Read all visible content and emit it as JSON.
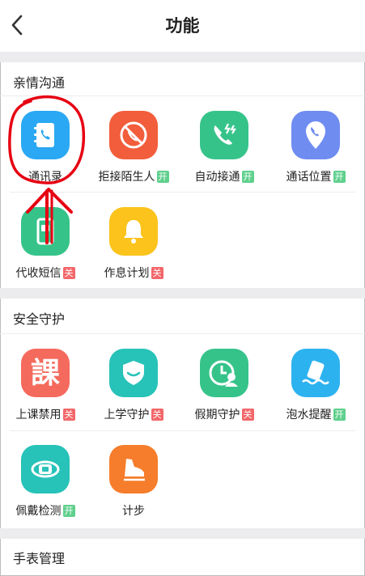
{
  "header": {
    "title": "功能"
  },
  "colors": {
    "blue": "#2aa8f3",
    "red": "#f25d3b",
    "green": "#36c38a",
    "purple": "#6f8cf1",
    "yellow": "#fbc31c",
    "coral": "#f46a5d",
    "teal": "#27c2b8",
    "sky": "#2db2f0",
    "orange": "#f67d2b",
    "badge_on": "#5fd08d",
    "badge_off": "#f2676a",
    "annotation": "#e60012"
  },
  "sections": [
    {
      "title": "亲情沟通",
      "items": [
        {
          "label": "通讯录",
          "badge": "",
          "icon": "contacts-book-icon"
        },
        {
          "label": "拒接陌生人",
          "badge": "开",
          "icon": "block-call-icon"
        },
        {
          "label": "自动接通",
          "badge": "开",
          "icon": "auto-answer-icon"
        },
        {
          "label": "通话位置",
          "badge": "开",
          "icon": "call-location-icon"
        },
        {
          "label": "代收短信",
          "badge": "关",
          "icon": "sms-receive-icon"
        },
        {
          "label": "作息计划",
          "badge": "关",
          "icon": "bell-icon"
        }
      ]
    },
    {
      "title": "安全守护",
      "items": [
        {
          "label": "上课禁用",
          "badge": "关",
          "icon": "class-character-icon",
          "glyph": "課"
        },
        {
          "label": "上学守护",
          "badge": "关",
          "icon": "school-shield-icon"
        },
        {
          "label": "假期守护",
          "badge": "关",
          "icon": "holiday-guard-icon"
        },
        {
          "label": "泡水提醒",
          "badge": "开",
          "icon": "water-alert-icon"
        },
        {
          "label": "佩戴检测",
          "badge": "开",
          "icon": "watch-wear-icon"
        },
        {
          "label": "计步",
          "badge": "",
          "icon": "shoe-step-icon"
        }
      ]
    },
    {
      "title": "手表管理",
      "items": []
    }
  ]
}
